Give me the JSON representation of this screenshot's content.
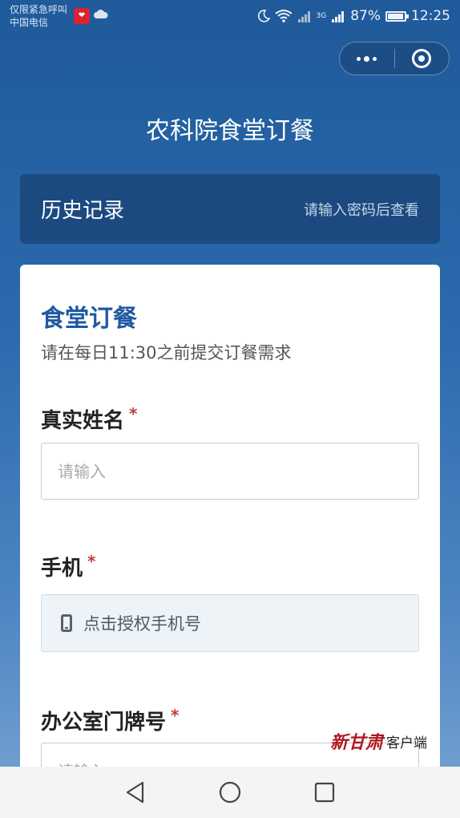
{
  "status_bar": {
    "carrier_line1": "仅限紧急呼叫",
    "carrier_line2": "中国电信",
    "network": "3G",
    "battery_percent_text": "87%",
    "battery_level": 0.87,
    "time": "12:25",
    "icons": [
      "app-icon",
      "cloud-icon",
      "moon-icon",
      "wifi-icon",
      "signal-icon",
      "battery-icon"
    ]
  },
  "capsule": {
    "more_icon": "more-dots-icon",
    "close_icon": "target-icon"
  },
  "page": {
    "title": "农科院食堂订餐"
  },
  "history": {
    "title": "历史记录",
    "hint": "请输入密码后查看"
  },
  "form": {
    "title": "食堂订餐",
    "subtitle": "请在每日11:30之前提交订餐需求",
    "required_mark": "*",
    "name_label": "真实姓名",
    "name_placeholder": "请输入",
    "phone_label": "手机",
    "phone_button": "点击授权手机号",
    "office_label": "办公室门牌号",
    "office_placeholder": "请输入"
  },
  "watermark": {
    "logo": "新甘肃",
    "text": "客户端"
  },
  "colors": {
    "primary": "#1f5aa0",
    "header_bg": "#1f5a9a",
    "required": "#c43b3b"
  }
}
